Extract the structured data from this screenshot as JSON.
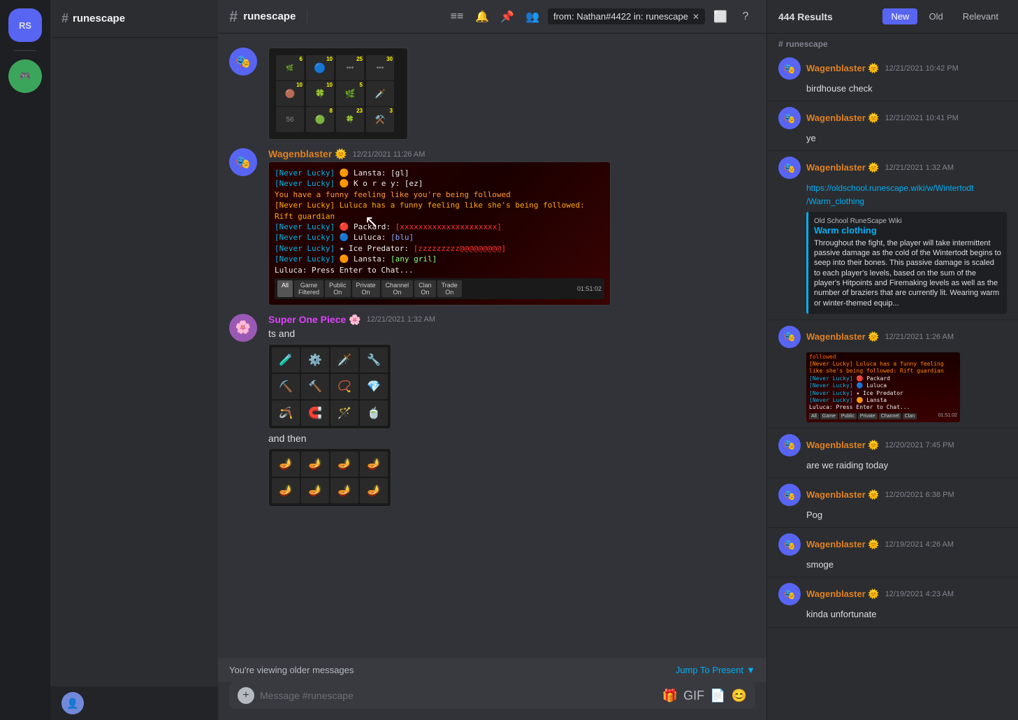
{
  "app": {
    "title": "runescape"
  },
  "header": {
    "channel_hash": "#",
    "channel_name": "runescape",
    "search_query": "from: Nathan#4422  in: runescape",
    "icon_threads": "≡",
    "icon_bell": "🔔",
    "icon_pin": "📌",
    "icon_person": "👤",
    "icon_layout": "⬜",
    "icon_help": "?"
  },
  "search_panel": {
    "results_count": "444 Results",
    "filters": [
      "New",
      "Old",
      "Relevant"
    ],
    "active_filter": "New",
    "channel_label": "runescape",
    "results": [
      {
        "author": "Wagenblaster",
        "emoji": "🌞",
        "timestamp": "12/21/2021 10:42 PM",
        "text": "birdhouse check",
        "type": "text"
      },
      {
        "author": "Wagenblaster",
        "emoji": "🌞",
        "timestamp": "12/21/2021 10:41 PM",
        "text": "ye",
        "type": "text"
      },
      {
        "author": "Wagenblaster",
        "emoji": "🌞",
        "timestamp": "12/21/2021 1:32 AM",
        "text": "https://oldschool.runescape.wiki/w/Wintertodt/Warm_clothing",
        "type": "link",
        "embed": {
          "provider": "Old School RuneScape Wiki",
          "title": "Warm clothing",
          "description": "Throughout the fight, the player will take intermittent passive damage as the cold of the Wintertodt begins to seep into their bones. This passive damage is scaled to each player's levels, based on the sum of the player's Hitpoints and Firemaking levels as well as the number of braziers that are currently lit. Wearing warm or winter-themed equip..."
        }
      },
      {
        "author": "Wagenblaster",
        "emoji": "🌞",
        "timestamp": "12/21/2021 1:26 AM",
        "text": "",
        "type": "screenshot"
      },
      {
        "author": "Wagenblaster",
        "emoji": "🌞",
        "timestamp": "12/20/2021 7:45 PM",
        "text": "are we raiding today",
        "type": "text"
      },
      {
        "author": "Wagenblaster",
        "emoji": "🌞",
        "timestamp": "12/20/2021 6:38 PM",
        "text": "Pog",
        "type": "text"
      },
      {
        "author": "Wagenblaster",
        "emoji": "🌞",
        "timestamp": "12/19/2021 4:26 AM",
        "text": "smoge",
        "type": "text"
      },
      {
        "author": "Wagenblaster",
        "emoji": "🌞",
        "timestamp": "12/19/2021 4:23 AM",
        "text": "kinda unfortunate",
        "type": "text"
      }
    ]
  },
  "messages": [
    {
      "author": "Wagenblaster",
      "emoji": "🌞",
      "timestamp": "12/21/2021 11:26 AM",
      "type": "screenshot"
    },
    {
      "author": "Super One Piece",
      "emoji": "🌸",
      "timestamp": "12/21/2021 1:32 AM",
      "text_before": "ts and",
      "text_after": "and then",
      "type": "inventory"
    }
  ],
  "bottom_bar": {
    "older_messages_text": "You're viewing older messages",
    "jump_label": "Jump To Present",
    "input_placeholder": "Message #runescape"
  },
  "game_chat": {
    "lines": [
      "[Never Lucky] 🟠 Lansta: [gl]",
      "[Never Lucky] 🟠 K o r e y: [ez]",
      "You have a funny feeling like you're being followed",
      "[Never Lucky] Luluca has a funny feeling like she's being followed: Rift guardian",
      "[Never Lucky] 🔴 Packard: [xxxxxxxxxxxxxxxxxxxxx]",
      "[Never Lucky] 🔵 Luluca: [blu]",
      "[Never Lucky] ✦ Ice Predator: [zzzzzzzzz@@@@@@@@@]",
      "[Never Lucky] 🟠 Lansta: [any gril]",
      "Luluca: Press Enter to Chat..."
    ],
    "tabs": [
      "All",
      "Game Filter",
      "Public On",
      "Private On",
      "Channel On",
      "Clan On",
      "Trade On"
    ],
    "timer": "01:51:02"
  }
}
